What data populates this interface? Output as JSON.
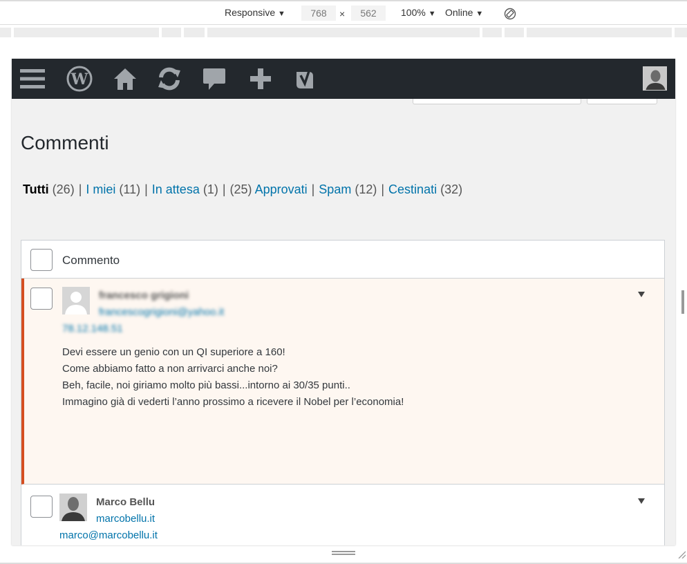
{
  "devtools": {
    "device": "Responsive",
    "width": "768",
    "times": "×",
    "height": "562",
    "zoom": "100%",
    "network": "Online",
    "caret": "▼"
  },
  "adminbar": {
    "icons": [
      "menu-icon",
      "wordpress-icon",
      "home-icon",
      "updates-icon",
      "comments-icon",
      "new-content-icon",
      "yoast-icon"
    ]
  },
  "page": {
    "title": "Commenti"
  },
  "filters": [
    {
      "label": "Tutti",
      "count": "(26)",
      "current": true
    },
    {
      "label": "I miei",
      "count": "(11)"
    },
    {
      "label": "In attesa",
      "count": "(1)"
    },
    {
      "label": "Approvati",
      "count_before": "(25)"
    },
    {
      "label": "Spam",
      "count": "(12)"
    },
    {
      "label": "Cestinati",
      "count": "(32)"
    }
  ],
  "filter_separator": "|",
  "table": {
    "header_label": "Commento"
  },
  "comments": [
    {
      "author": "francesco grigioni",
      "email": "francescogrigioni@yahoo.it",
      "ip": "78.12.148.51",
      "lines": [
        "Devi essere un genio con un QI superiore a 160!",
        "Come abbiamo fatto a non arrivarci anche noi?",
        "Beh, facile, noi giriamo molto più bassi...intorno ai 30/35 punti..",
        "Immagino già di vederti l’anno prossimo a ricevere il Nobel per l’economia!"
      ]
    },
    {
      "author": "Marco Bellu",
      "url": "marcobellu.it",
      "email": "marco@marcobellu.it"
    }
  ]
}
